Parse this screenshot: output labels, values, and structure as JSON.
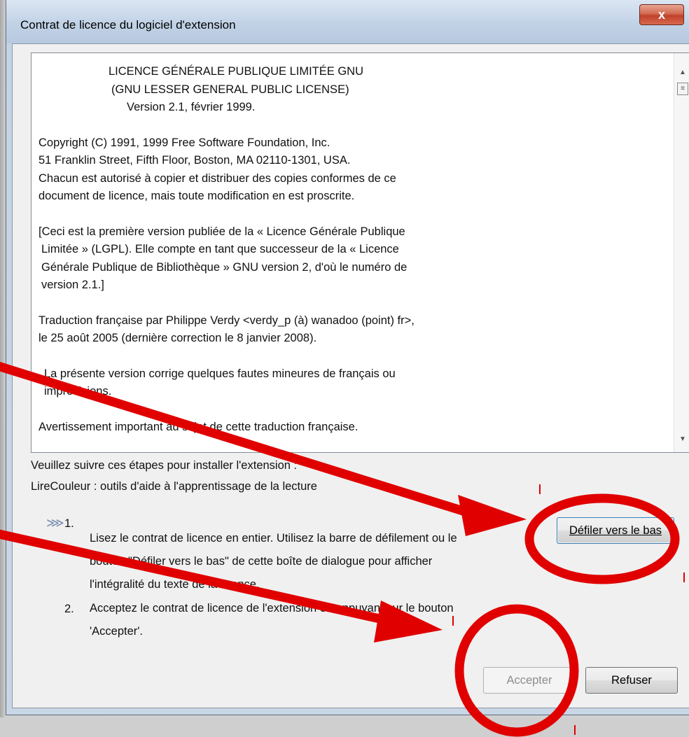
{
  "window": {
    "title": "Contrat de licence du logiciel d'extension",
    "close_label": "x"
  },
  "license": {
    "lines": [
      "LICENCE GÉNÉRALE PUBLIQUE LIMITÉE GNU",
      "(GNU LESSER GENERAL PUBLIC LICENSE)",
      "Version 2.1, février 1999.",
      "Copyright (C) 1991, 1999 Free Software Foundation, Inc.",
      "51 Franklin Street, Fifth Floor, Boston, MA 02110-1301, USA.",
      "Chacun est autorisé à copier et distribuer des copies conformes de ce",
      "document de licence, mais toute modification en est proscrite.",
      "[Ceci est la première version publiée de la « Licence Générale Publique",
      " Limitée » (LGPL). Elle compte en tant que successeur de la « Licence",
      " Générale Publique de Bibliothèque » GNU version 2, d'où le numéro de",
      " version 2.1.]",
      "Traduction française par Philippe Verdy <verdy_p (à) wanadoo (point) fr>,",
      "le 25 août 2005 (dernière correction le 8 janvier 2008).",
      "  La présente version corrige quelques fautes mineures de français ou",
      "  imprécisions.",
      "Avertissement important au sujet de cette traduction française."
    ]
  },
  "instructions": {
    "line1": "Veuillez suivre ces étapes pour installer l'extension :",
    "line2": "LireCouleur : outils d'aide à l'apprentissage de la lecture",
    "step1_number": "1.",
    "step1_lines": [
      "Lisez le contrat de licence en entier. Utilisez la barre de défilement ou le",
      "bouton \"Défiler vers le bas\" de cette boîte de dialogue pour afficher",
      "l'intégralité du texte de la licence."
    ],
    "step2_number": "2.",
    "step2_lines": [
      "Acceptez le contrat de licence de l'extension en appuyant sur le bouton",
      "'Accepter'."
    ]
  },
  "buttons": {
    "scroll_down": "Défiler vers le bas",
    "accept": "Accepter",
    "refuse": "Refuser"
  },
  "colors": {
    "annotation": "#e00000",
    "window_frame": "#c4d3e4",
    "close_button": "#c0412a"
  }
}
